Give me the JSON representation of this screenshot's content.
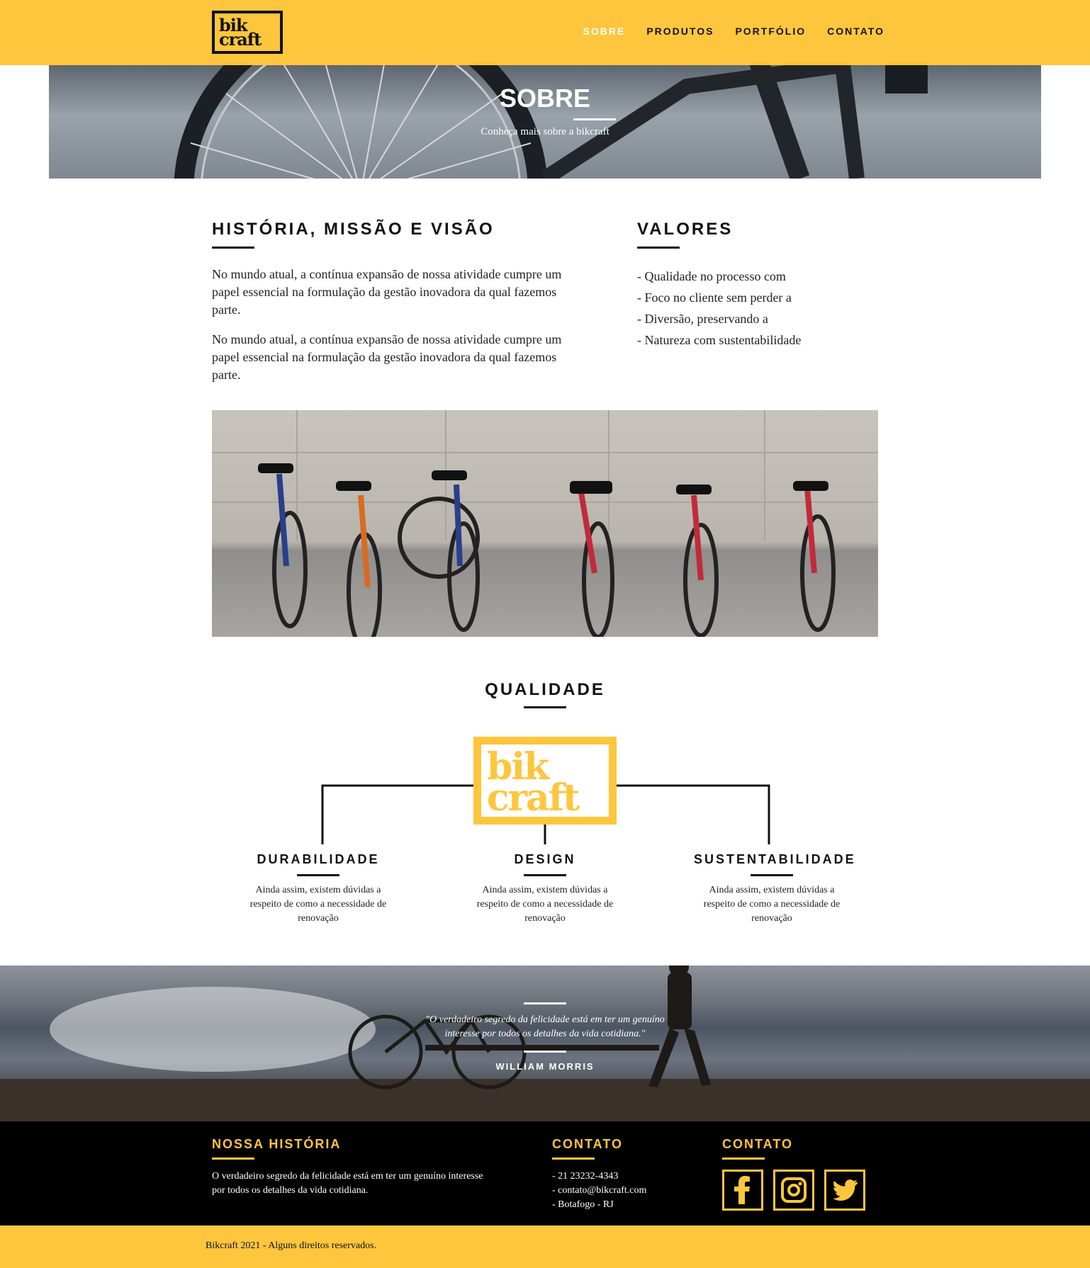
{
  "header": {
    "logo_line1": "bik",
    "logo_line2": "craft",
    "nav": [
      "SOBRE",
      "PRODUTOS",
      "PORTFÓLIO",
      "CONTATO"
    ]
  },
  "hero": {
    "title": "SOBRE",
    "subtitle": "Conheça mais sobre a bikcraft"
  },
  "history": {
    "title": "HISTÓRIA, MISSÃO E VISÃO",
    "paragraphs": [
      "No mundo atual, a contínua expansão de nossa atividade cumpre um papel essencial na formulação da gestão inovadora da qual fazemos parte.",
      "No mundo atual, a contínua expansão de nossa atividade cumpre um papel essencial na formulação da gestão inovadora da qual fazemos parte."
    ]
  },
  "values": {
    "title": "VALORES",
    "items": [
      "- Qualidade no processo com",
      "- Foco no cliente sem perder a",
      "- Diversão, preservando a",
      "- Natureza com sustentabilidade"
    ]
  },
  "quality": {
    "title": "QUALIDADE",
    "logo_line1": "bik",
    "logo_line2": "craft",
    "items": [
      {
        "title": "DURABILIDADE",
        "text": "Ainda assim, existem dúvidas a respeito de como a necessidade de renovação"
      },
      {
        "title": "DESIGN",
        "text": "Ainda assim, existem dúvidas a respeito de como a necessidade de renovação"
      },
      {
        "title": "SUSTENTABILIDADE",
        "text": "Ainda assim, existem dúvidas a respeito de como a necessidade de renovação"
      }
    ]
  },
  "quote": {
    "line1": "\"O verdadeiro segredo da felicidade está em ter um genuíno",
    "line2": "interesse por todos os detalhes da vida cotidiana.\"",
    "author": "WILLIAM MORRIS"
  },
  "footer": {
    "history_title": "NOSSA HISTÓRIA",
    "history_text": "O verdadeiro segredo da felicidade está em ter um genuíno interesse por todos os detalhes da vida cotidiana.",
    "contact_title": "CONTATO",
    "contact_items": [
      "- 21 23232-4343",
      "- contato@bikcraft.com",
      "- Botafogo - RJ"
    ],
    "social_title": "CONTATO",
    "social_icons": [
      "facebook-icon",
      "instagram-icon",
      "twitter-icon"
    ]
  },
  "copyright": "Bikcraft 2021 - Alguns direitos reservados.",
  "colors": {
    "accent": "#fec63d",
    "dark": "#000000",
    "text": "#111111"
  }
}
